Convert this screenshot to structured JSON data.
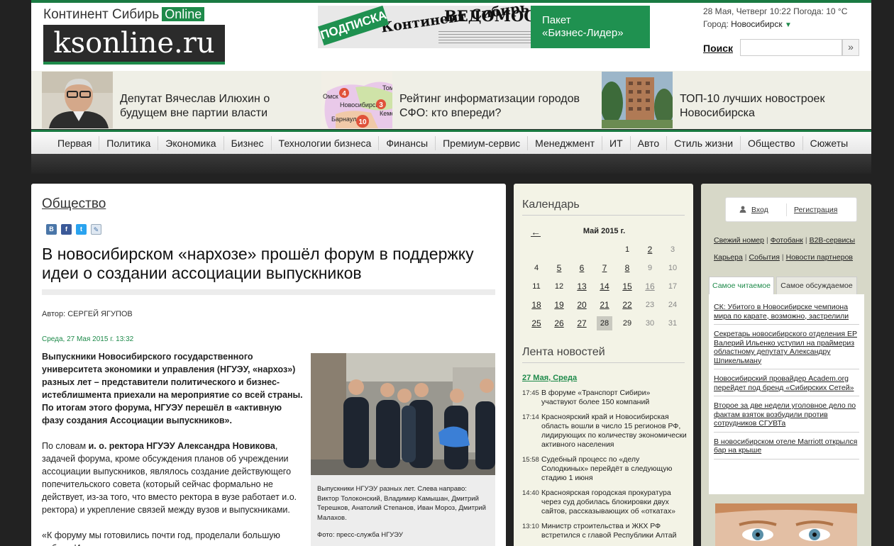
{
  "header": {
    "logo_top": "Континент Сибирь",
    "logo_badge": "Online",
    "logo_main": "ksonline.ru",
    "date_weather": "28 Мая, Четверг 10:22 Погода: 10 °С",
    "city_label": "Город:",
    "city_value": "Новосибирск",
    "search_label": "Поиск",
    "search_placeholder": "",
    "search_btn": "»"
  },
  "banner": {
    "badge": "ПОДПИСКА",
    "paper1": "Континент Сибирь",
    "paper2": "ВЕДОМОСТИ",
    "text_line1": "Пакет",
    "text_line2": "«Бизнес-Лидер»"
  },
  "teasers": [
    {
      "text": "Депутат Вячеслав Илюхин о будущем вне партии власти"
    },
    {
      "text": "Рейтинг информатизации городов СФО: кто впереди?",
      "map_labels": [
        "Омск",
        "Том",
        "Новосибирск",
        "Кеме",
        "Барнаул"
      ],
      "map_numbers": [
        "4",
        "3",
        "10"
      ]
    },
    {
      "text": "ТОП-10 лучших новостроек Новосибирска"
    }
  ],
  "nav": [
    "Первая",
    "Политика",
    "Экономика",
    "Бизнес",
    "Технологии бизнеса",
    "Финансы",
    "Премиум-сервис",
    "Менеджмент",
    "ИТ",
    "Авто",
    "Стиль жизни",
    "Общество",
    "Сюжеты"
  ],
  "article": {
    "section": "Общество",
    "share": [
      "В",
      "f",
      "t",
      "✎"
    ],
    "headline": "В новосибирском «нархозе» прошёл форум в поддержку идеи о создании ассоциации выпускников",
    "author": "Автор: СЕРГЕЙ ЯГУПОВ",
    "pubdate": "Среда, 27 Мая 2015 г. 13:32",
    "lead": "Выпускники Новосибирского государственного университета экономики и управления (НГУЭУ, «нархоз») разных лет – представители политического и бизнес-истеблишмента приехали на мероприятие со всей страны. По итогам этого форума, НГУЭУ перешёл в «активную фазу создания Ассоциации выпускников».",
    "para1_a": "По словам ",
    "para1_b": "и. о. ректора НГУЭУ Александра Новикова",
    "para1_c": ", задачей форума, кроме обсуждения планов об учреждении ассоциации выпускников, являлось создание действующего попечительского совета (который сейчас формально не действует, из-за того, что вместо ректора в вузе работает и.о. ректора) и укрепление связей между вузов и выпускниками.",
    "para2": "«К форуму мы готовились почти год, проделали большую работу. И …",
    "caption": "Выпускники НГУЭУ разных лет. Слева направо: Виктор Толоконский, Владимир Камышан, Дмитрий Терешков, Анатолий Степанов, Иван Мороз, Дмитрий Малахов.",
    "caption_source": "Фото: пресс-служба НГУЭУ"
  },
  "calendar": {
    "title": "Календарь",
    "prev": "←",
    "month": "Май 2015 г.",
    "weeks": [
      [
        [
          "",
          ""
        ],
        [
          "",
          ""
        ],
        [
          "",
          ""
        ],
        [
          "",
          ""
        ],
        [
          "1",
          "p"
        ],
        [
          "2",
          "l"
        ],
        [
          "3",
          "g"
        ]
      ],
      [
        [
          "4",
          "p"
        ],
        [
          "5",
          "l"
        ],
        [
          "6",
          "l"
        ],
        [
          "7",
          "l"
        ],
        [
          "8",
          "l"
        ],
        [
          "9",
          "g"
        ],
        [
          "10",
          "g"
        ]
      ],
      [
        [
          "11",
          "p"
        ],
        [
          "12",
          "p"
        ],
        [
          "13",
          "l"
        ],
        [
          "14",
          "l"
        ],
        [
          "15",
          "l"
        ],
        [
          "16",
          "gl"
        ],
        [
          "17",
          "g"
        ]
      ],
      [
        [
          "18",
          "l"
        ],
        [
          "19",
          "l"
        ],
        [
          "20",
          "l"
        ],
        [
          "21",
          "l"
        ],
        [
          "22",
          "l"
        ],
        [
          "23",
          "g"
        ],
        [
          "24",
          "g"
        ]
      ],
      [
        [
          "25",
          "l"
        ],
        [
          "26",
          "l"
        ],
        [
          "27",
          "l"
        ],
        [
          "28",
          "t"
        ],
        [
          "29",
          "p"
        ],
        [
          "30",
          "g"
        ],
        [
          "31",
          "g"
        ]
      ]
    ]
  },
  "news": {
    "title": "Лента новостей",
    "date": "27 Мая, Среда",
    "items": [
      {
        "time": "17:45",
        "text": "В форуме «Транспорт Сибири» участвуют более 150 компаний"
      },
      {
        "time": "17:14",
        "text": "Красноярский край и Новосибирская область вошли в число 15 регионов РФ, лидирующих по количеству экономически активного населения"
      },
      {
        "time": "15:58",
        "text": "Судебный процесс по «делу Солодкиных» перейдёт в следующую стадию 1 июня"
      },
      {
        "time": "14:40",
        "text": "Красноярская городская прокуратура через суд добилась блокировки двух сайтов, рассказывающих об «откатах»"
      },
      {
        "time": "13:10",
        "text": "Министр строительства и ЖКХ РФ встретился с главой Республики Алтай"
      }
    ]
  },
  "sidebar": {
    "login": "Вход",
    "register": "Регистрация",
    "links_row1": [
      "Свежий номер",
      "Фотобанк",
      "B2B-сервисы"
    ],
    "links_row2": [
      "Карьера",
      "События",
      "Новости партнеров"
    ],
    "tab_read": "Самое читаемое",
    "tab_discussed": "Самое обсуждаемое",
    "top": [
      "СК: Убитого в Новосибирске чемпиона мира по карате, возможно, застрелили",
      "Секретарь новосибирского отделения ЕР Валерий Ильенко уступил на праймериз областному депутату Александру Шпикельману",
      "Новосибирский провайдер Academ.org перейдет под бренд «Сибирских Сетей»",
      "Второе за две недели уголовное дело по фактам взяток возбудили против сотрудников СГУВТа",
      "В новосибирском отеле Marriott открылся бар на крыше"
    ]
  },
  "colors": {
    "brand_green": "#1e8a4a",
    "dark": "#222222",
    "mid_bg": "#f3f3e6",
    "right_bg": "#d7d8c8"
  }
}
